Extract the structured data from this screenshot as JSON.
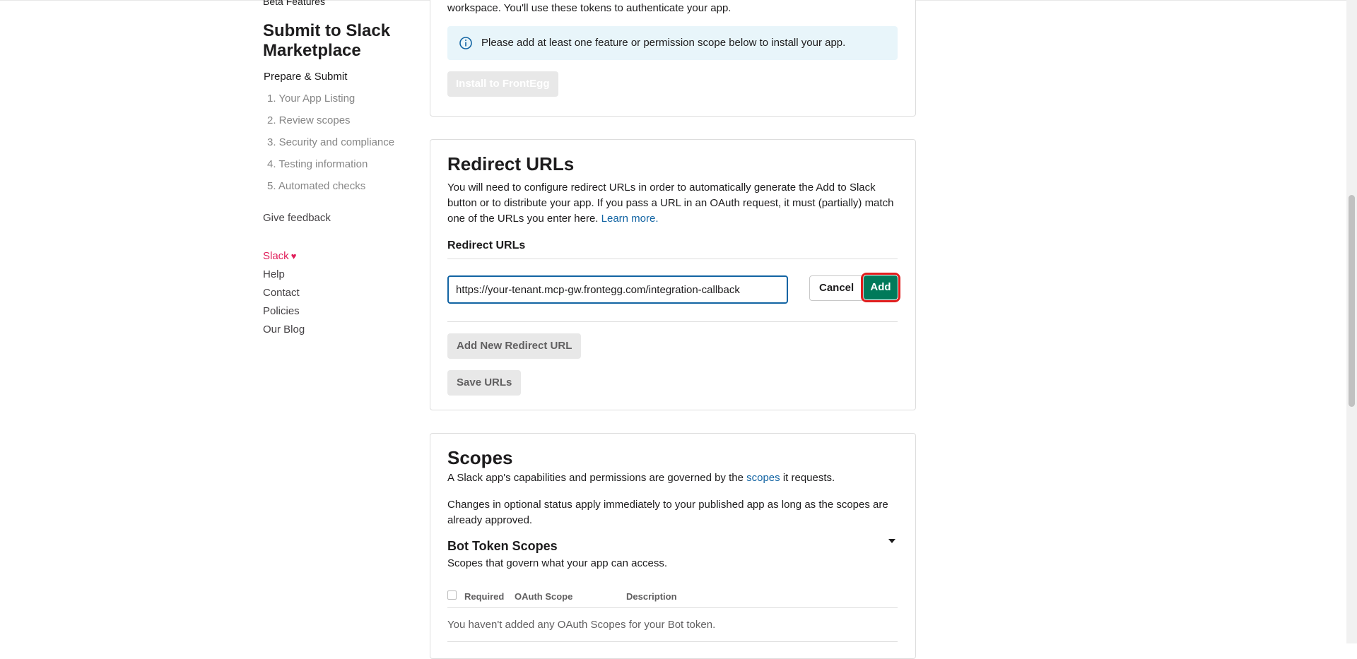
{
  "sidebar": {
    "beta_features": "Beta Features",
    "heading": "Submit to Slack Marketplace",
    "subheading": "Prepare & Submit",
    "steps": [
      "1. Your App Listing",
      "2. Review scopes",
      "3. Security and compliance",
      "4. Testing information",
      "5. Automated checks"
    ],
    "give_feedback": "Give feedback",
    "footer": {
      "slack": "Slack",
      "heart": "♥",
      "help": "Help",
      "contact": "Contact",
      "policies": "Policies",
      "blog": "Our Blog"
    }
  },
  "oauth_tokens": {
    "intro_text": "workspace. You'll use these tokens to authenticate your app.",
    "info_text": "Please add at least one feature or permission scope below to install your app.",
    "install_button": "Install to FrontEgg"
  },
  "redirect_urls": {
    "title": "Redirect URLs",
    "description": "You will need to configure redirect URLs in order to automatically generate the Add to Slack button or to distribute your app. If you pass a URL in an OAuth request, it must (partially) match one of the URLs you enter here.",
    "learn_more": "Learn more.",
    "label": "Redirect URLs",
    "input_value": "https://your-tenant.mcp-gw.frontegg.com/integration-callback",
    "cancel_button": "Cancel",
    "add_button": "Add",
    "add_new_button": "Add New Redirect URL",
    "save_button": "Save URLs"
  },
  "scopes": {
    "title": "Scopes",
    "description_prefix": "A Slack app's capabilities and permissions are governed by the",
    "description_link": "scopes",
    "description_suffix": "it requests.",
    "optional_note": "Changes in optional status apply immediately to your published app as long as the scopes are already approved.",
    "bot_title": "Bot Token Scopes",
    "bot_desc": "Scopes that govern what your app can access.",
    "col_required": "Required",
    "col_oauth": "OAuth Scope",
    "col_description": "Description",
    "empty_text": "You haven't added any OAuth Scopes for your Bot token."
  },
  "colors": {
    "primary_green": "#007a5a",
    "link_blue": "#1264a3",
    "highlight_red": "#e01e1e",
    "slack_pink": "#e01e5a",
    "info_bg": "#e8f5fa"
  },
  "icons": [
    "info-icon",
    "heart-icon",
    "caret-down-icon"
  ]
}
